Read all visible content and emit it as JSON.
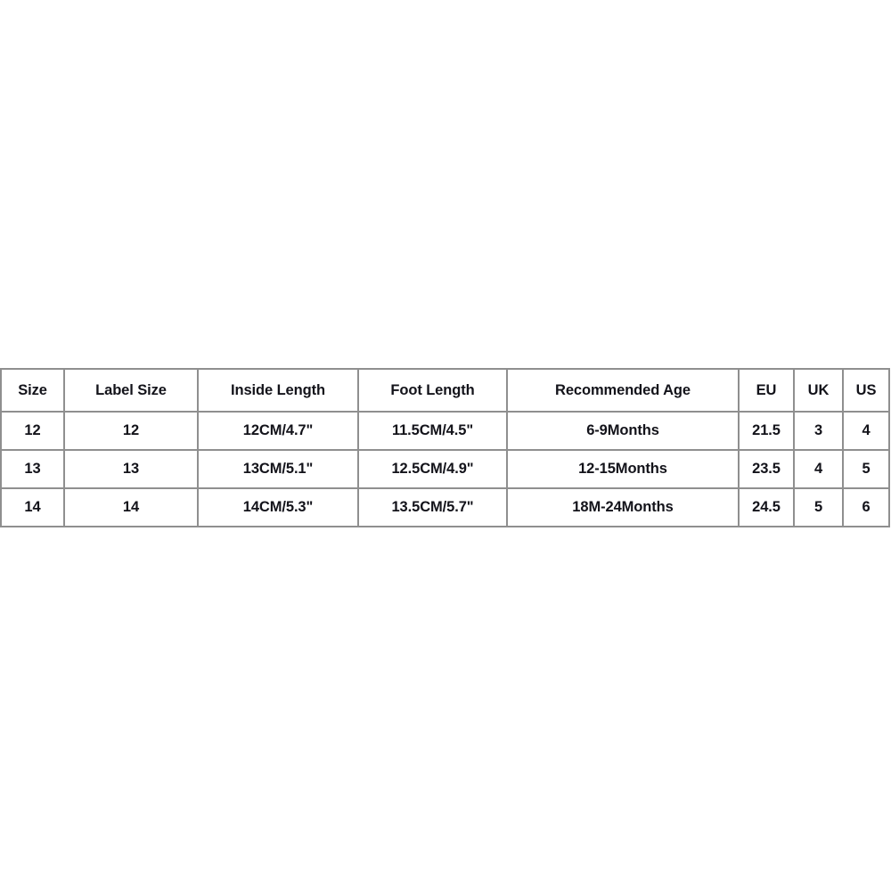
{
  "page": {
    "background_color": "#ffffff",
    "border_color": "#8f8f8f",
    "text_color": "#13131a"
  },
  "size_chart": {
    "columns": [
      "Size",
      "Label Size",
      "Inside Length",
      "Foot Length",
      "Recommended Age",
      "EU",
      "UK",
      "US"
    ],
    "rows": [
      {
        "size": "12",
        "label_size": "12",
        "inside_length": "12CM/4.7\"",
        "foot_length": "11.5CM/4.5\"",
        "recommended_age": "6-9Months",
        "eu": "21.5",
        "uk": "3",
        "us": "4"
      },
      {
        "size": "13",
        "label_size": "13",
        "inside_length": "13CM/5.1\"",
        "foot_length": "12.5CM/4.9\"",
        "recommended_age": "12-15Months",
        "eu": "23.5",
        "uk": "4",
        "us": "5"
      },
      {
        "size": "14",
        "label_size": "14",
        "inside_length": "14CM/5.3\"",
        "foot_length": "13.5CM/5.7\"",
        "recommended_age": "18M-24Months",
        "eu": "24.5",
        "uk": "5",
        "us": "6"
      }
    ]
  }
}
